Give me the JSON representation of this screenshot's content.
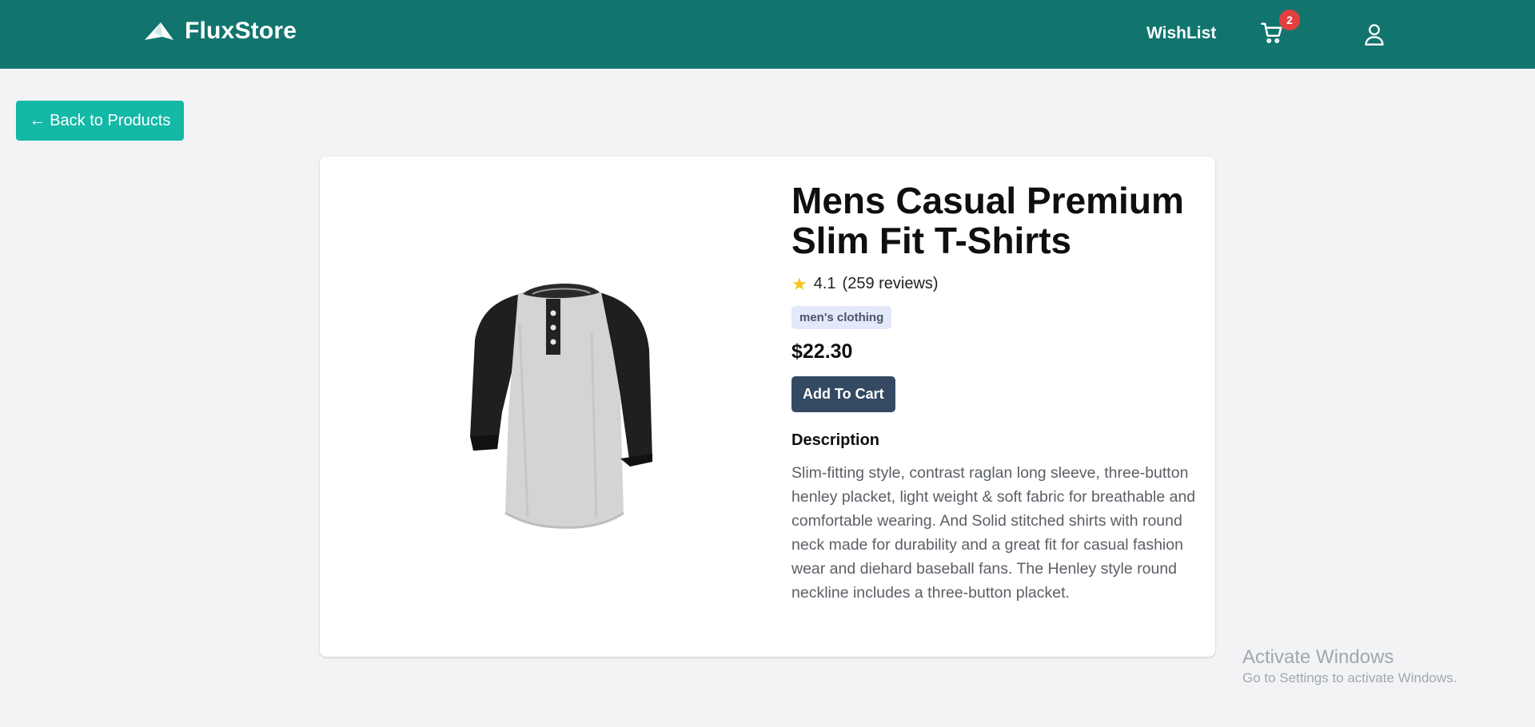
{
  "header": {
    "brand_name": "FluxStore",
    "wishlist_label": "WishList",
    "cart_count": "2",
    "logo_icon": "paper-plane-logo",
    "cart_icon": "shopping-cart-icon",
    "user_icon": "user-icon",
    "background_color": "#11756e"
  },
  "navigation": {
    "back_label": "← Back to Products",
    "back_button_color": "#14b8a6"
  },
  "product": {
    "title": "Mens Casual Premium Slim Fit T-Shirts",
    "rating": "4.1",
    "reviews": "(259 reviews)",
    "category": "men's clothing",
    "price": "$22.30",
    "add_to_cart_label": "Add To Cart",
    "description_heading": "Description",
    "description": "Slim-fitting style, contrast raglan long sleeve, three-button henley placket, light weight & soft fabric for breathable and comfortable wearing. And Solid stitched shirts with round neck made for durability and a great fit for casual fashion wear and diehard baseball fans. The Henley style round neckline includes a three-button placket.",
    "image_icon": "henley-tshirt-image"
  },
  "watermark": {
    "title": "Activate Windows",
    "subtitle": "Go to Settings to activate Windows."
  }
}
